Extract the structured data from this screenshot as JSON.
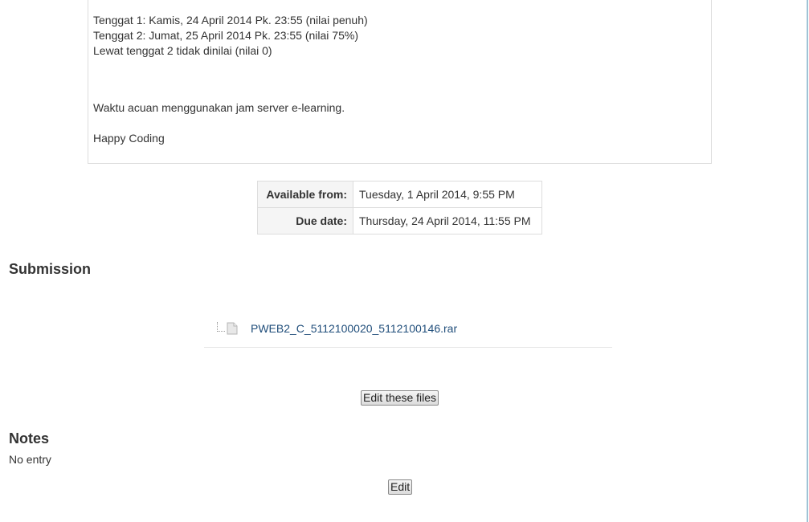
{
  "intro": {
    "lines": [
      "Tenggat 1: Kamis, 24 April 2014 Pk. 23:55 (nilai penuh)",
      "Tenggat 2: Jumat, 25 April 2014 Pk. 23:55 (nilai 75%)",
      "Lewat tenggat 2 tidak dinilai (nilai 0)",
      "Waktu acuan menggunakan jam server e-learning.",
      "Happy Coding"
    ]
  },
  "dates": {
    "available_label": "Available from:",
    "available_value": "Tuesday, 1 April 2014, 9:55 PM",
    "due_label": "Due date:",
    "due_value": "Thursday, 24 April 2014, 11:55 PM"
  },
  "submission": {
    "heading": "Submission",
    "file_name": "PWEB2_C_5112100020_5112100146.rar",
    "file_icon": "file-icon",
    "edit_files_label": "Edit these files"
  },
  "notes": {
    "heading": "Notes",
    "text": "No entry",
    "edit_label": "Edit"
  },
  "colors": {
    "link": "#1f4d7a",
    "border": "#dddddd",
    "header_bg": "#f5f5f5",
    "right_edge": "#9fc3d6"
  }
}
